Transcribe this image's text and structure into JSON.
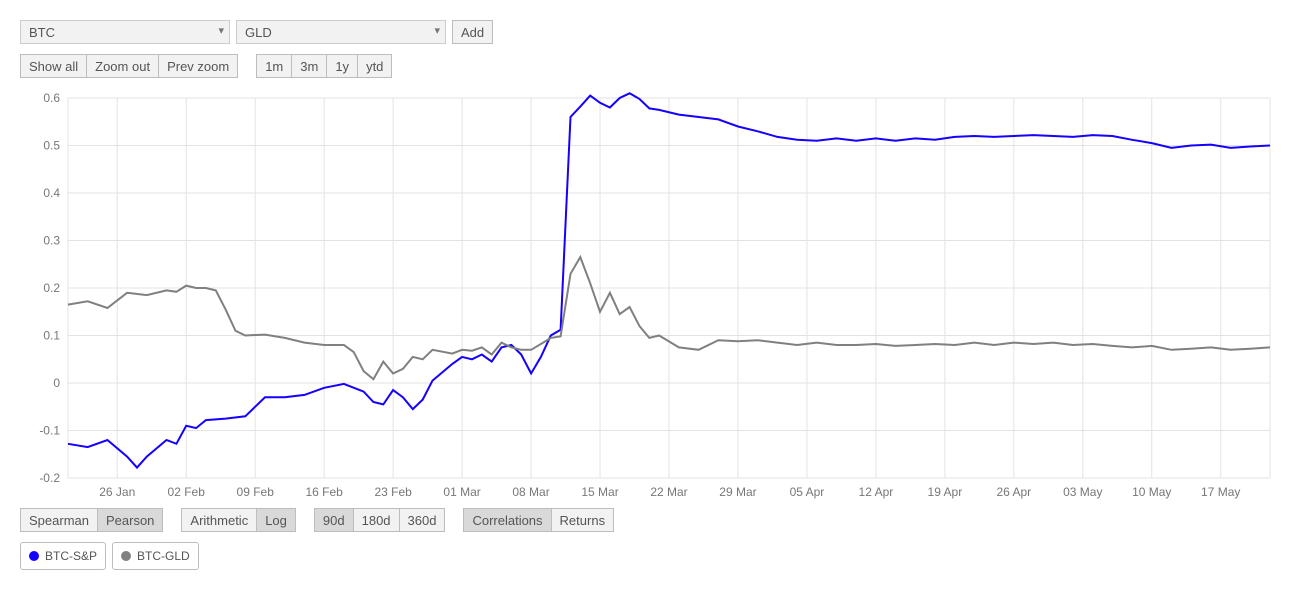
{
  "select1": {
    "value": "BTC",
    "options": [
      "BTC"
    ]
  },
  "select2": {
    "value": "GLD",
    "options": [
      "GLD"
    ]
  },
  "add_label": "Add",
  "view_buttons": {
    "show_all": "Show all",
    "zoom_out": "Zoom out",
    "prev_zoom": "Prev zoom"
  },
  "range_buttons": {
    "m1": "1m",
    "m3": "3m",
    "y1": "1y",
    "ytd": "ytd"
  },
  "corr_type": {
    "spearman": "Spearman",
    "pearson": "Pearson"
  },
  "return_type": {
    "arithmetic": "Arithmetic",
    "log": "Log"
  },
  "window_buttons": {
    "d90": "90d",
    "d180": "180d",
    "d360": "360d"
  },
  "mode_buttons": {
    "correlations": "Correlations",
    "returns": "Returns"
  },
  "legend": [
    {
      "label": "BTC-S&P",
      "color": "#1500ff"
    },
    {
      "label": "BTC-GLD",
      "color": "#808080"
    }
  ],
  "chart_data": {
    "type": "line",
    "xlabel": "",
    "ylabel": "",
    "ylim": [
      -0.2,
      0.6
    ],
    "yticks": [
      -0.2,
      -0.1,
      0,
      0.1,
      0.2,
      0.3,
      0.4,
      0.5,
      0.6
    ],
    "xticks": [
      "26 Jan",
      "02 Feb",
      "09 Feb",
      "16 Feb",
      "23 Feb",
      "01 Mar",
      "08 Mar",
      "15 Mar",
      "22 Mar",
      "29 Mar",
      "05 Apr",
      "12 Apr",
      "19 Apr",
      "26 Apr",
      "03 May",
      "10 May",
      "17 May"
    ],
    "x_range": [
      "2020-01-21",
      "2020-05-22"
    ],
    "series": [
      {
        "name": "BTC-S&P",
        "color": "#1500ff",
        "data": [
          [
            "2020-01-21",
            -0.128
          ],
          [
            "2020-01-23",
            -0.135
          ],
          [
            "2020-01-25",
            -0.12
          ],
          [
            "2020-01-27",
            -0.155
          ],
          [
            "2020-01-28",
            -0.178
          ],
          [
            "2020-01-29",
            -0.155
          ],
          [
            "2020-01-31",
            -0.12
          ],
          [
            "2020-02-01",
            -0.128
          ],
          [
            "2020-02-02",
            -0.09
          ],
          [
            "2020-02-03",
            -0.095
          ],
          [
            "2020-02-04",
            -0.078
          ],
          [
            "2020-02-06",
            -0.075
          ],
          [
            "2020-02-08",
            -0.07
          ],
          [
            "2020-02-10",
            -0.03
          ],
          [
            "2020-02-12",
            -0.03
          ],
          [
            "2020-02-14",
            -0.025
          ],
          [
            "2020-02-16",
            -0.01
          ],
          [
            "2020-02-18",
            -0.002
          ],
          [
            "2020-02-20",
            -0.018
          ],
          [
            "2020-02-21",
            -0.04
          ],
          [
            "2020-02-22",
            -0.045
          ],
          [
            "2020-02-23",
            -0.015
          ],
          [
            "2020-02-24",
            -0.03
          ],
          [
            "2020-02-25",
            -0.055
          ],
          [
            "2020-02-26",
            -0.035
          ],
          [
            "2020-02-27",
            0.005
          ],
          [
            "2020-02-29",
            0.04
          ],
          [
            "2020-03-01",
            0.055
          ],
          [
            "2020-03-02",
            0.05
          ],
          [
            "2020-03-03",
            0.06
          ],
          [
            "2020-03-04",
            0.045
          ],
          [
            "2020-03-05",
            0.075
          ],
          [
            "2020-03-06",
            0.08
          ],
          [
            "2020-03-07",
            0.06
          ],
          [
            "2020-03-08",
            0.02
          ],
          [
            "2020-03-09",
            0.055
          ],
          [
            "2020-03-10",
            0.1
          ],
          [
            "2020-03-11",
            0.112
          ],
          [
            "2020-03-12",
            0.56
          ],
          [
            "2020-03-13",
            0.582
          ],
          [
            "2020-03-14",
            0.605
          ],
          [
            "2020-03-15",
            0.59
          ],
          [
            "2020-03-16",
            0.58
          ],
          [
            "2020-03-17",
            0.6
          ],
          [
            "2020-03-18",
            0.61
          ],
          [
            "2020-03-19",
            0.598
          ],
          [
            "2020-03-20",
            0.578
          ],
          [
            "2020-03-21",
            0.575
          ],
          [
            "2020-03-23",
            0.565
          ],
          [
            "2020-03-25",
            0.56
          ],
          [
            "2020-03-27",
            0.555
          ],
          [
            "2020-03-29",
            0.54
          ],
          [
            "2020-03-31",
            0.53
          ],
          [
            "2020-04-02",
            0.518
          ],
          [
            "2020-04-04",
            0.512
          ],
          [
            "2020-04-06",
            0.51
          ],
          [
            "2020-04-08",
            0.515
          ],
          [
            "2020-04-10",
            0.51
          ],
          [
            "2020-04-12",
            0.515
          ],
          [
            "2020-04-14",
            0.51
          ],
          [
            "2020-04-16",
            0.515
          ],
          [
            "2020-04-18",
            0.512
          ],
          [
            "2020-04-20",
            0.518
          ],
          [
            "2020-04-22",
            0.52
          ],
          [
            "2020-04-24",
            0.518
          ],
          [
            "2020-04-26",
            0.52
          ],
          [
            "2020-04-28",
            0.522
          ],
          [
            "2020-04-30",
            0.52
          ],
          [
            "2020-05-02",
            0.518
          ],
          [
            "2020-05-04",
            0.522
          ],
          [
            "2020-05-06",
            0.52
          ],
          [
            "2020-05-08",
            0.512
          ],
          [
            "2020-05-10",
            0.505
          ],
          [
            "2020-05-12",
            0.495
          ],
          [
            "2020-05-14",
            0.5
          ],
          [
            "2020-05-16",
            0.502
          ],
          [
            "2020-05-18",
            0.495
          ],
          [
            "2020-05-20",
            0.498
          ],
          [
            "2020-05-22",
            0.5
          ]
        ]
      },
      {
        "name": "BTC-GLD",
        "color": "#808080",
        "data": [
          [
            "2020-01-21",
            0.165
          ],
          [
            "2020-01-23",
            0.172
          ],
          [
            "2020-01-25",
            0.158
          ],
          [
            "2020-01-27",
            0.19
          ],
          [
            "2020-01-29",
            0.185
          ],
          [
            "2020-01-31",
            0.195
          ],
          [
            "2020-02-01",
            0.192
          ],
          [
            "2020-02-02",
            0.205
          ],
          [
            "2020-02-03",
            0.2
          ],
          [
            "2020-02-04",
            0.2
          ],
          [
            "2020-02-05",
            0.195
          ],
          [
            "2020-02-06",
            0.155
          ],
          [
            "2020-02-07",
            0.11
          ],
          [
            "2020-02-08",
            0.1
          ],
          [
            "2020-02-10",
            0.102
          ],
          [
            "2020-02-12",
            0.095
          ],
          [
            "2020-02-14",
            0.085
          ],
          [
            "2020-02-16",
            0.08
          ],
          [
            "2020-02-18",
            0.08
          ],
          [
            "2020-02-19",
            0.065
          ],
          [
            "2020-02-20",
            0.025
          ],
          [
            "2020-02-21",
            0.008
          ],
          [
            "2020-02-22",
            0.045
          ],
          [
            "2020-02-23",
            0.02
          ],
          [
            "2020-02-24",
            0.03
          ],
          [
            "2020-02-25",
            0.055
          ],
          [
            "2020-02-26",
            0.05
          ],
          [
            "2020-02-27",
            0.07
          ],
          [
            "2020-02-29",
            0.062
          ],
          [
            "2020-03-01",
            0.07
          ],
          [
            "2020-03-02",
            0.068
          ],
          [
            "2020-03-03",
            0.075
          ],
          [
            "2020-03-04",
            0.06
          ],
          [
            "2020-03-05",
            0.085
          ],
          [
            "2020-03-06",
            0.075
          ],
          [
            "2020-03-07",
            0.07
          ],
          [
            "2020-03-08",
            0.07
          ],
          [
            "2020-03-09",
            0.082
          ],
          [
            "2020-03-10",
            0.095
          ],
          [
            "2020-03-11",
            0.098
          ],
          [
            "2020-03-12",
            0.23
          ],
          [
            "2020-03-13",
            0.265
          ],
          [
            "2020-03-14",
            0.21
          ],
          [
            "2020-03-15",
            0.15
          ],
          [
            "2020-03-16",
            0.19
          ],
          [
            "2020-03-17",
            0.145
          ],
          [
            "2020-03-18",
            0.16
          ],
          [
            "2020-03-19",
            0.12
          ],
          [
            "2020-03-20",
            0.095
          ],
          [
            "2020-03-21",
            0.1
          ],
          [
            "2020-03-23",
            0.075
          ],
          [
            "2020-03-25",
            0.07
          ],
          [
            "2020-03-27",
            0.09
          ],
          [
            "2020-03-29",
            0.088
          ],
          [
            "2020-03-31",
            0.09
          ],
          [
            "2020-04-02",
            0.085
          ],
          [
            "2020-04-04",
            0.08
          ],
          [
            "2020-04-06",
            0.085
          ],
          [
            "2020-04-08",
            0.08
          ],
          [
            "2020-04-10",
            0.08
          ],
          [
            "2020-04-12",
            0.082
          ],
          [
            "2020-04-14",
            0.078
          ],
          [
            "2020-04-16",
            0.08
          ],
          [
            "2020-04-18",
            0.082
          ],
          [
            "2020-04-20",
            0.08
          ],
          [
            "2020-04-22",
            0.085
          ],
          [
            "2020-04-24",
            0.08
          ],
          [
            "2020-04-26",
            0.085
          ],
          [
            "2020-04-28",
            0.082
          ],
          [
            "2020-04-30",
            0.085
          ],
          [
            "2020-05-02",
            0.08
          ],
          [
            "2020-05-04",
            0.082
          ],
          [
            "2020-05-06",
            0.078
          ],
          [
            "2020-05-08",
            0.075
          ],
          [
            "2020-05-10",
            0.078
          ],
          [
            "2020-05-12",
            0.07
          ],
          [
            "2020-05-14",
            0.072
          ],
          [
            "2020-05-16",
            0.075
          ],
          [
            "2020-05-18",
            0.07
          ],
          [
            "2020-05-20",
            0.072
          ],
          [
            "2020-05-22",
            0.075
          ]
        ]
      }
    ]
  }
}
